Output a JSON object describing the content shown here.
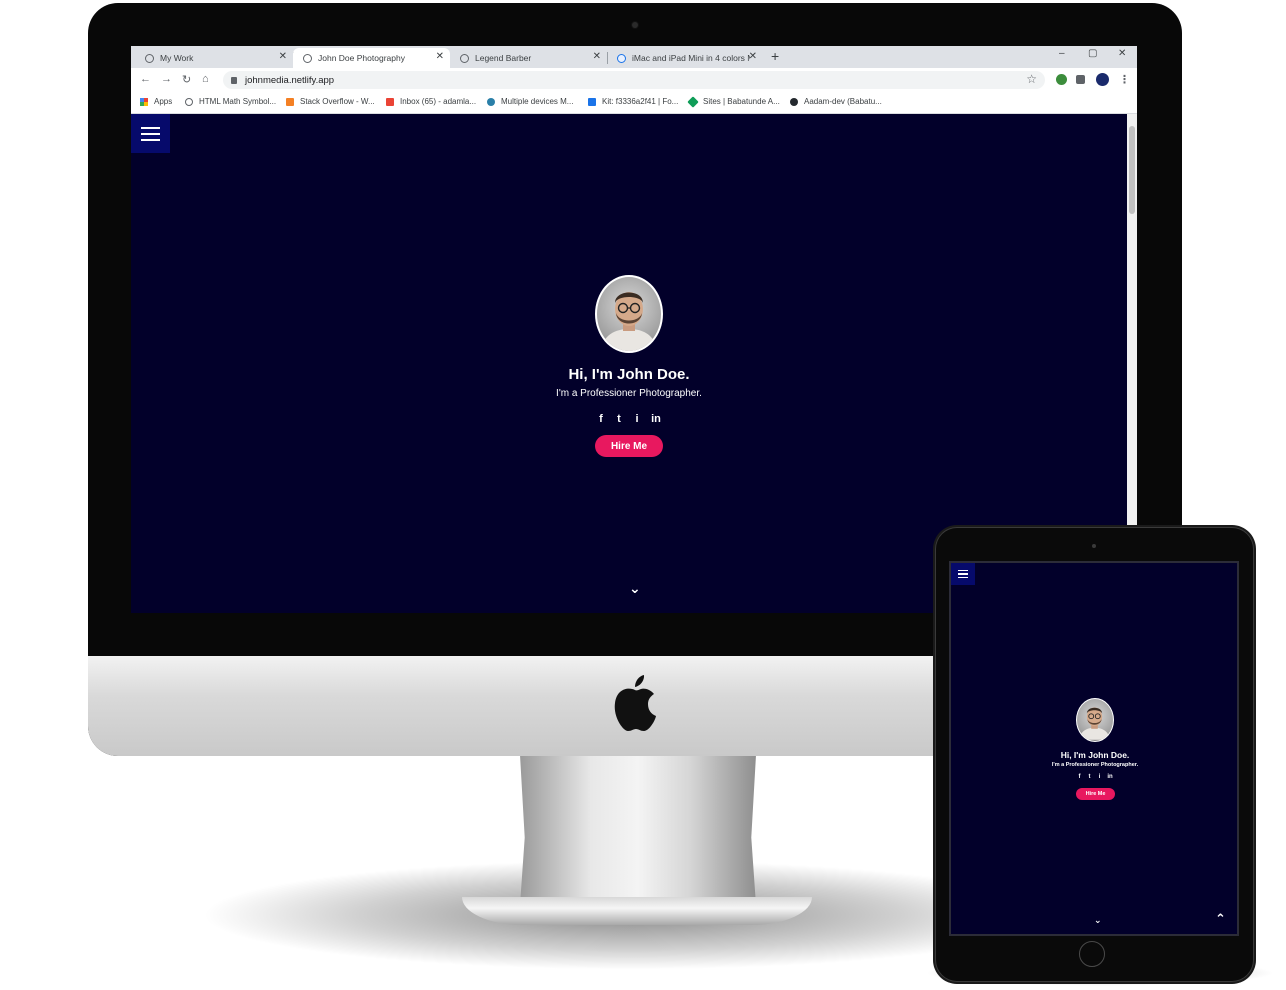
{
  "browser": {
    "tabs": [
      {
        "label": "My Work",
        "active": false
      },
      {
        "label": "John Doe Photography",
        "active": true
      },
      {
        "label": "Legend Barber",
        "active": false
      },
      {
        "label": "iMac and iPad Mini in 4 colors M",
        "active": false
      }
    ],
    "new_tab": "+",
    "window_controls": {
      "minimize": "–",
      "maximize": "▢",
      "close": "✕"
    },
    "nav": {
      "back": "←",
      "forward": "→",
      "reload": "↻",
      "home": "⌂"
    },
    "url": "johnmedia.netlify.app",
    "star": "☆",
    "menu": "⋮",
    "bookmarks": [
      "Apps",
      "HTML Math Symbol...",
      "Stack Overflow - W...",
      "Inbox (65) - adamla...",
      "Multiple devices M...",
      "Kit: f3336a2f41 | Fo...",
      "Sites | Babatunde A...",
      "Aadam-dev (Babatu..."
    ]
  },
  "hero": {
    "name": "Hi, I'm John Doe.",
    "subtitle": "I'm a Professioner Photographer.",
    "socials": [
      "f",
      "t",
      "i",
      "in"
    ],
    "cta": "Hire Me",
    "scroll_down": "⌄"
  },
  "ipad": {
    "name": "Hi, I'm John Doe.",
    "subtitle": "I'm a Professioner Photographer.",
    "socials": [
      "f",
      "t",
      "i",
      "in"
    ],
    "cta": "Hire Me",
    "scroll_down": "⌄",
    "back_to_top": "⌃"
  },
  "colors": {
    "page_bg": "#02002a",
    "nav_btn": "#060a6b",
    "accent": "#e8185f"
  }
}
